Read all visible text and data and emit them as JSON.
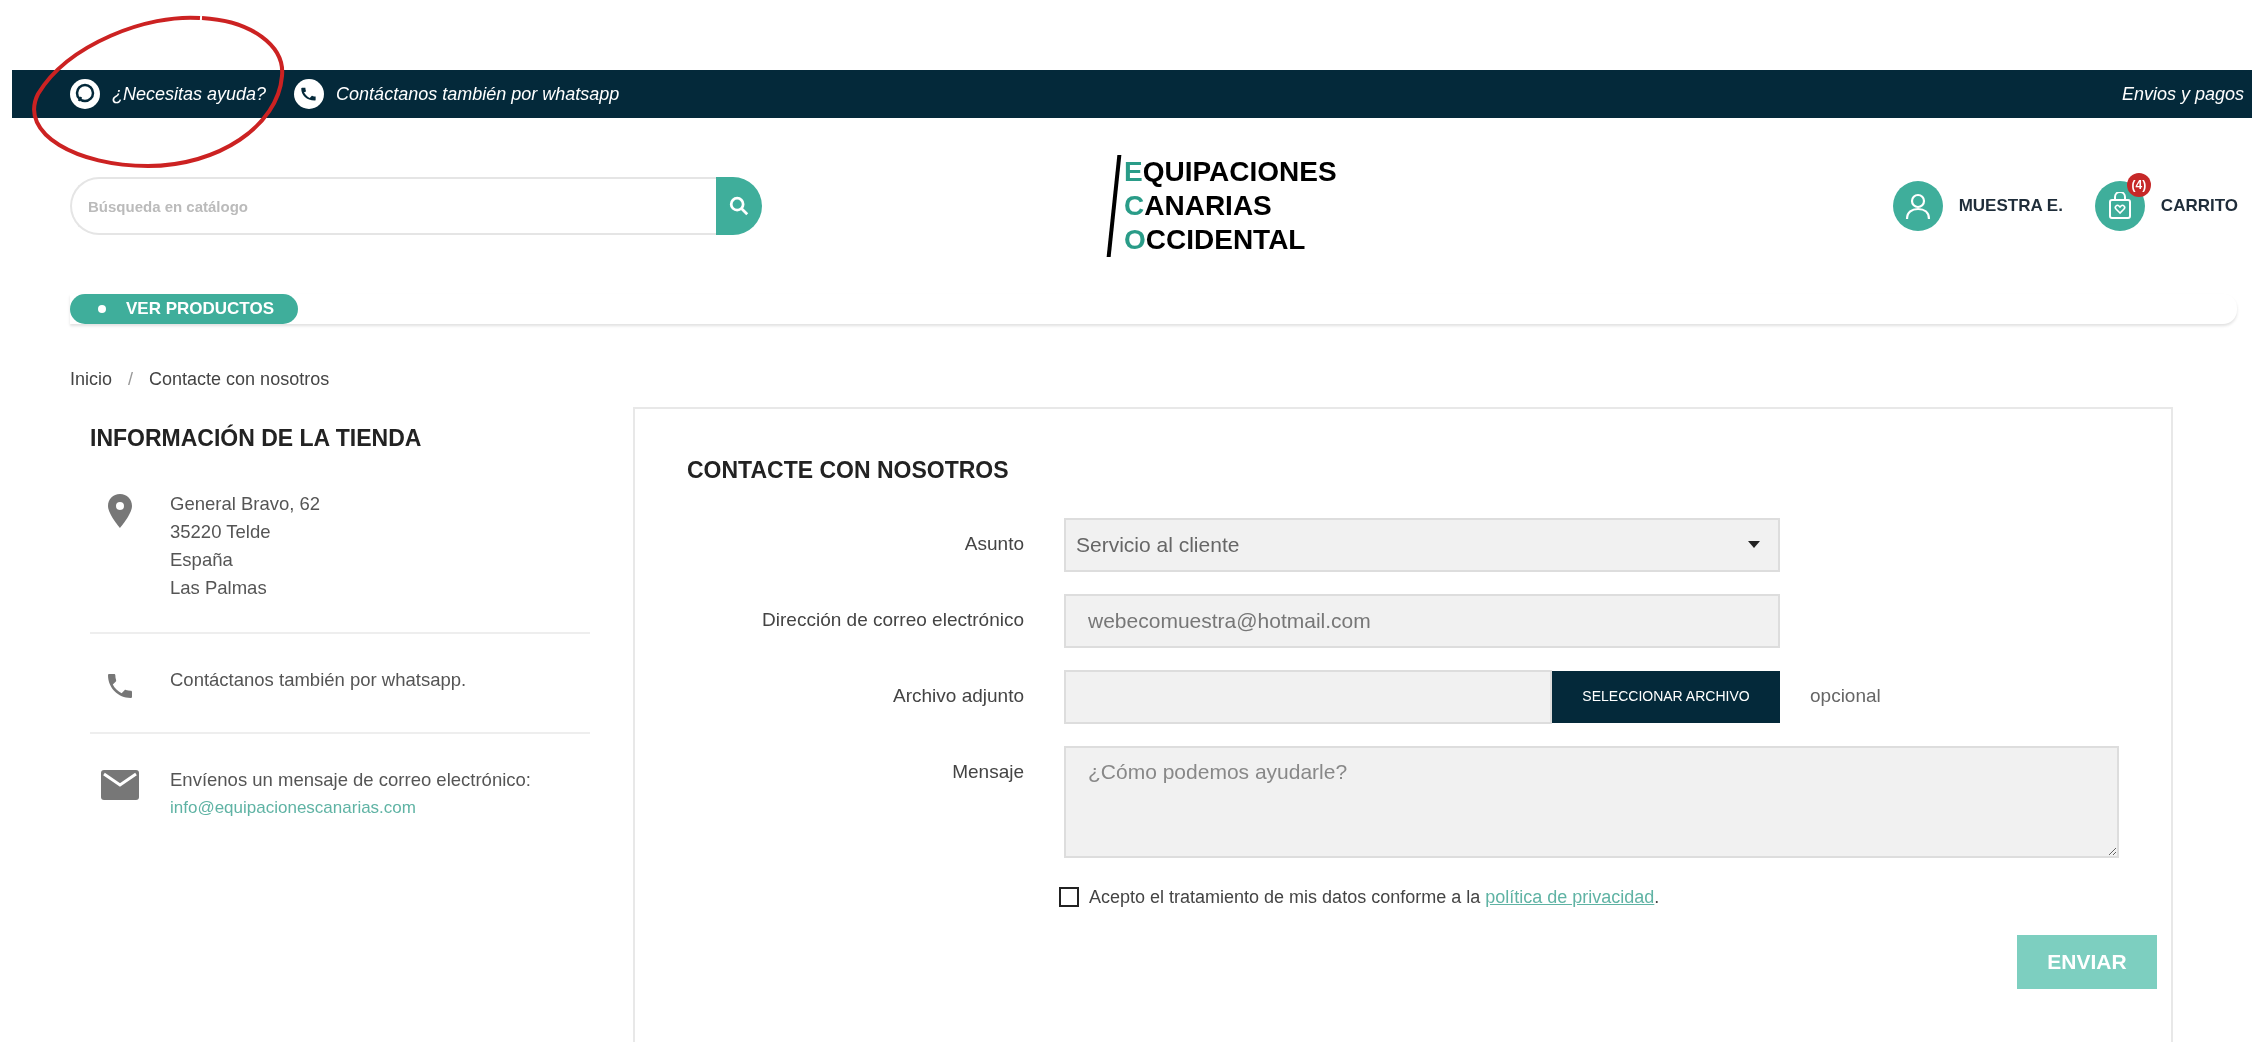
{
  "top_bar": {
    "help": "¿Necesitas ayuda?",
    "whatsapp": "Contáctanos también por whatsapp",
    "shipping": "Envios y pagos"
  },
  "header": {
    "search": {
      "placeholder": "Búsqueda en catálogo"
    },
    "logo": [
      {
        "initial": "E",
        "rest": "QUIPACIONES"
      },
      {
        "initial": "C",
        "rest": "ANARIAS"
      },
      {
        "initial": "O",
        "rest": "CCIDENTAL"
      }
    ],
    "account": "MUESTRA E.",
    "cart": {
      "label": "CARRITO",
      "count": "(4)"
    }
  },
  "menu": {
    "button": "VER PRODUCTOS"
  },
  "breadcrumb": {
    "items": [
      "Inicio",
      "Contacte con nosotros"
    ],
    "separator": "/"
  },
  "store_info": {
    "title": "INFORMACIÓN DE LA TIENDA",
    "items": [
      {
        "kind": "address",
        "lines": [
          "General Bravo, 62",
          "35220 Telde",
          "España",
          "Las Palmas"
        ]
      },
      {
        "kind": "phone",
        "lines": [
          "Contáctanos también por whatsapp."
        ]
      },
      {
        "kind": "email",
        "lines": [
          "Envíenos un mensaje de correo electrónico:"
        ],
        "link": "info@equipacionescanarias.com"
      }
    ]
  },
  "contact_form": {
    "title": "CONTACTE CON NOSOTROS",
    "subject": {
      "label": "Asunto",
      "value": "Servicio al cliente"
    },
    "email": {
      "label": "Dirección de correo electrónico",
      "value": "webecomuestra@hotmail.com"
    },
    "attachment": {
      "label": "Archivo adjunto",
      "button": "SELECCIONAR ARCHIVO",
      "note": "opcional"
    },
    "message": {
      "label": "Mensaje",
      "placeholder": "¿Cómo podemos ayudarle?"
    },
    "consent": {
      "checked": false,
      "text": "Acepto el tratamiento de mis datos conforme a la",
      "link": "política de privacidad",
      "after": "."
    },
    "submit": "ENVIAR"
  }
}
